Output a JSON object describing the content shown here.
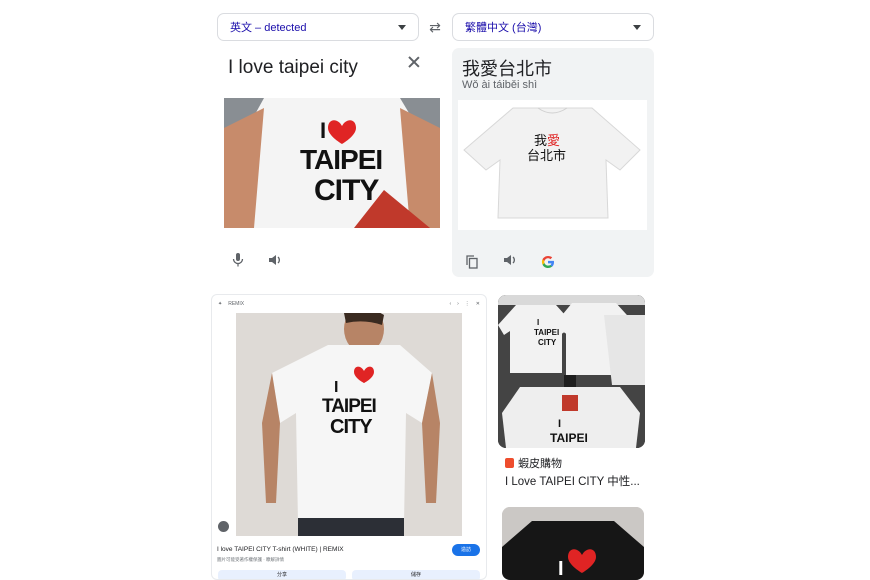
{
  "translate": {
    "source_lang": "英文 – detected",
    "target_lang": "繁體中文 (台灣)",
    "source_text": "I love taipei city",
    "target_text": "我愛台北市",
    "romanization": "Wǒ ài táiběi shì"
  },
  "source_image_print": {
    "line1": "I",
    "line2": "TAIPEI",
    "line3": "CITY"
  },
  "target_image_print": {
    "line1": "我",
    "line1b": "愛",
    "line2": "台北市"
  },
  "card": {
    "site": "REMIX",
    "caption": "I love TAIPEI CITY T-shirt (WHITE) | REMIX",
    "sub": "圖片可能受著作權保護 · 瞭解詳情",
    "visit": "造訪",
    "share": "分享",
    "save": "儲存",
    "print": {
      "line1": "I",
      "line2": "TAIPEI",
      "line3": "CITY"
    }
  },
  "result": {
    "shop_name": "蝦皮購物",
    "title": "I Love TAIPEI CITY 中性..."
  },
  "thumb_print": {
    "line1": "I",
    "line2": "TAIPEI",
    "line3": "CITY"
  },
  "thumb2_print": {
    "line1": "I"
  },
  "colors": {
    "heart": "#e02424",
    "link": "#1a0dab",
    "google_blue": "#4285f4"
  }
}
